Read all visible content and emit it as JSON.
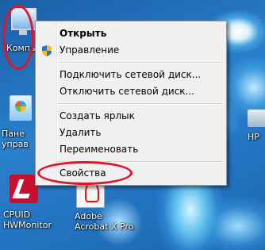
{
  "desktop": {
    "icons": [
      {
        "label": "Компь"
      },
      {
        "label": "Пане\nуправ"
      },
      {
        "label": "CPUID\nHWMonitor"
      },
      {
        "label": "Adobe\nAcrobat X Pro"
      },
      {
        "label": "HP"
      }
    ]
  },
  "context_menu": {
    "items": [
      {
        "label": "Открыть",
        "bold": true
      },
      {
        "label": "Управление"
      },
      {
        "label": "Подключить сетевой диск..."
      },
      {
        "label": "Отключить сетевой диск..."
      },
      {
        "label": "Создать ярлык"
      },
      {
        "label": "Удалить"
      },
      {
        "label": "Переименовать"
      },
      {
        "label": "Свойства"
      }
    ]
  },
  "annotation_color": "#e3142a",
  "icons": [
    "computer-icon",
    "control-panel-icon",
    "cpuid-hwmonitor-icon",
    "adobe-acrobat-icon",
    "hp-icon",
    "uac-shield-icon"
  ]
}
